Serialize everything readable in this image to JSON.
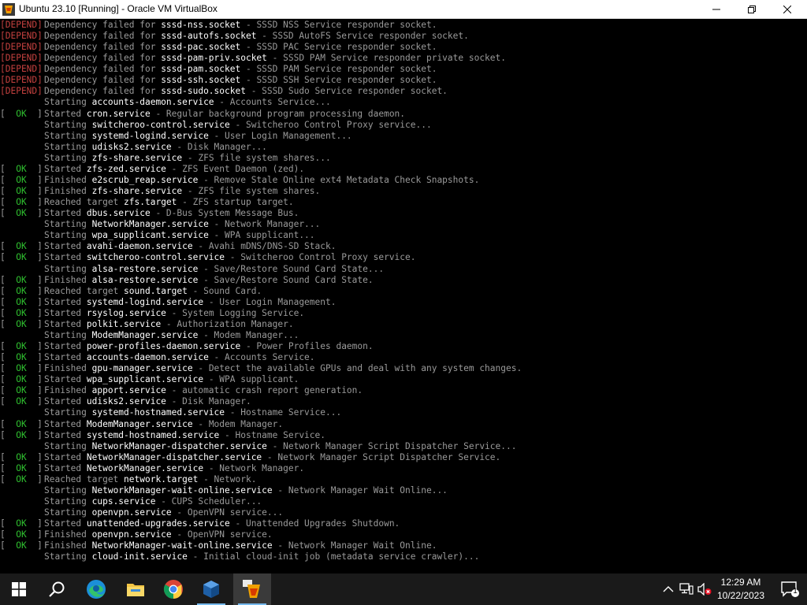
{
  "window": {
    "title": "Ubuntu 23.10 [Running] - Oracle VM VirtualBox",
    "controls": [
      "minimize",
      "maximize",
      "close"
    ]
  },
  "console": {
    "lines": [
      {
        "status": "DEPEND",
        "verb": "Dependency failed for",
        "unit": "sssd-nss.socket",
        "desc": " - SSSD NSS Service responder socket."
      },
      {
        "status": "DEPEND",
        "verb": "Dependency failed for",
        "unit": "sssd-autofs.socket",
        "desc": " - SSSD AutoFS Service responder socket."
      },
      {
        "status": "DEPEND",
        "verb": "Dependency failed for",
        "unit": "sssd-pac.socket",
        "desc": " - SSSD PAC Service responder socket."
      },
      {
        "status": "DEPEND",
        "verb": "Dependency failed for",
        "unit": "sssd-pam-priv.socket",
        "desc": " - SSSD PAM Service responder private socket."
      },
      {
        "status": "DEPEND",
        "verb": "Dependency failed for",
        "unit": "sssd-pam.socket",
        "desc": " - SSSD PAM Service responder socket."
      },
      {
        "status": "DEPEND",
        "verb": "Dependency failed for",
        "unit": "sssd-ssh.socket",
        "desc": " - SSSD SSH Service responder socket."
      },
      {
        "status": "DEPEND",
        "verb": "Dependency failed for",
        "unit": "sssd-sudo.socket",
        "desc": " - SSSD Sudo Service responder socket."
      },
      {
        "status": "",
        "verb": "Starting",
        "unit": "accounts-daemon.service",
        "desc": " - Accounts Service..."
      },
      {
        "status": "OK",
        "verb": "Started",
        "unit": "cron.service",
        "desc": " - Regular background program processing daemon."
      },
      {
        "status": "",
        "verb": "Starting",
        "unit": "switcheroo-control.service",
        "desc": " - Switcheroo Control Proxy service..."
      },
      {
        "status": "",
        "verb": "Starting",
        "unit": "systemd-logind.service",
        "desc": " - User Login Management..."
      },
      {
        "status": "",
        "verb": "Starting",
        "unit": "udisks2.service",
        "desc": " - Disk Manager..."
      },
      {
        "status": "",
        "verb": "Starting",
        "unit": "zfs-share.service",
        "desc": " - ZFS file system shares..."
      },
      {
        "status": "OK",
        "verb": "Started",
        "unit": "zfs-zed.service",
        "desc": " - ZFS Event Daemon (zed)."
      },
      {
        "status": "OK",
        "verb": "Finished",
        "unit": "e2scrub_reap.service",
        "desc": " - Remove Stale Online ext4 Metadata Check Snapshots."
      },
      {
        "status": "OK",
        "verb": "Finished",
        "unit": "zfs-share.service",
        "desc": " - ZFS file system shares."
      },
      {
        "status": "OK",
        "verb": "Reached target",
        "unit": "zfs.target",
        "desc": " - ZFS startup target."
      },
      {
        "status": "OK",
        "verb": "Started",
        "unit": "dbus.service",
        "desc": " - D-Bus System Message Bus."
      },
      {
        "status": "",
        "verb": "Starting",
        "unit": "NetworkManager.service",
        "desc": " - Network Manager..."
      },
      {
        "status": "",
        "verb": "Starting",
        "unit": "wpa_supplicant.service",
        "desc": " - WPA supplicant..."
      },
      {
        "status": "OK",
        "verb": "Started",
        "unit": "avahi-daemon.service",
        "desc": " - Avahi mDNS/DNS-SD Stack."
      },
      {
        "status": "OK",
        "verb": "Started",
        "unit": "switcheroo-control.service",
        "desc": " - Switcheroo Control Proxy service."
      },
      {
        "status": "",
        "verb": "Starting",
        "unit": "alsa-restore.service",
        "desc": " - Save/Restore Sound Card State..."
      },
      {
        "status": "OK",
        "verb": "Finished",
        "unit": "alsa-restore.service",
        "desc": " - Save/Restore Sound Card State."
      },
      {
        "status": "OK",
        "verb": "Reached target",
        "unit": "sound.target",
        "desc": " - Sound Card."
      },
      {
        "status": "OK",
        "verb": "Started",
        "unit": "systemd-logind.service",
        "desc": " - User Login Management."
      },
      {
        "status": "OK",
        "verb": "Started",
        "unit": "rsyslog.service",
        "desc": " - System Logging Service."
      },
      {
        "status": "OK",
        "verb": "Started",
        "unit": "polkit.service",
        "desc": " - Authorization Manager."
      },
      {
        "status": "",
        "verb": "Starting",
        "unit": "ModemManager.service",
        "desc": " - Modem Manager..."
      },
      {
        "status": "OK",
        "verb": "Started",
        "unit": "power-profiles-daemon.service",
        "desc": " - Power Profiles daemon."
      },
      {
        "status": "OK",
        "verb": "Started",
        "unit": "accounts-daemon.service",
        "desc": " - Accounts Service."
      },
      {
        "status": "OK",
        "verb": "Finished",
        "unit": "gpu-manager.service",
        "desc": " - Detect the available GPUs and deal with any system changes."
      },
      {
        "status": "OK",
        "verb": "Started",
        "unit": "wpa_supplicant.service",
        "desc": " - WPA supplicant."
      },
      {
        "status": "OK",
        "verb": "Finished",
        "unit": "apport.service",
        "desc": " - automatic crash report generation."
      },
      {
        "status": "OK",
        "verb": "Started",
        "unit": "udisks2.service",
        "desc": " - Disk Manager."
      },
      {
        "status": "",
        "verb": "Starting",
        "unit": "systemd-hostnamed.service",
        "desc": " - Hostname Service..."
      },
      {
        "status": "OK",
        "verb": "Started",
        "unit": "ModemManager.service",
        "desc": " - Modem Manager."
      },
      {
        "status": "OK",
        "verb": "Started",
        "unit": "systemd-hostnamed.service",
        "desc": " - Hostname Service."
      },
      {
        "status": "",
        "verb": "Starting",
        "unit": "NetworkManager-dispatcher.service",
        "desc": " - Network Manager Script Dispatcher Service..."
      },
      {
        "status": "OK",
        "verb": "Started",
        "unit": "NetworkManager-dispatcher.service",
        "desc": " - Network Manager Script Dispatcher Service."
      },
      {
        "status": "OK",
        "verb": "Started",
        "unit": "NetworkManager.service",
        "desc": " - Network Manager."
      },
      {
        "status": "OK",
        "verb": "Reached target",
        "unit": "network.target",
        "desc": " - Network."
      },
      {
        "status": "",
        "verb": "Starting",
        "unit": "NetworkManager-wait-online.service",
        "desc": " - Network Manager Wait Online..."
      },
      {
        "status": "",
        "verb": "Starting",
        "unit": "cups.service",
        "desc": " - CUPS Scheduler..."
      },
      {
        "status": "",
        "verb": "Starting",
        "unit": "openvpn.service",
        "desc": " - OpenVPN service..."
      },
      {
        "status": "OK",
        "verb": "Started",
        "unit": "unattended-upgrades.service",
        "desc": " - Unattended Upgrades Shutdown."
      },
      {
        "status": "OK",
        "verb": "Finished",
        "unit": "openvpn.service",
        "desc": " - OpenVPN service."
      },
      {
        "status": "OK",
        "verb": "Finished",
        "unit": "NetworkManager-wait-online.service",
        "desc": " - Network Manager Wait Online."
      },
      {
        "status": "",
        "verb": "Starting",
        "unit": "cloud-init.service",
        "desc": " - Initial cloud-init job (metadata service crawler)..."
      }
    ]
  },
  "taskbar": {
    "apps": [
      {
        "name": "Start",
        "icon": "windows-start-icon"
      },
      {
        "name": "Search",
        "icon": "search-icon"
      },
      {
        "name": "Microsoft Edge",
        "icon": "edge-icon"
      },
      {
        "name": "File Explorer",
        "icon": "file-explorer-icon"
      },
      {
        "name": "Google Chrome",
        "icon": "chrome-icon"
      },
      {
        "name": "Oracle VM VirtualBox Manager",
        "icon": "virtualbox-icon"
      },
      {
        "name": "Ubuntu 23.10 [Running]",
        "icon": "virtualbox-vm-icon"
      }
    ],
    "tray": {
      "time": "12:29 AM",
      "date": "10/22/2023",
      "notification_count": "1"
    }
  },
  "colors": {
    "ok": "#2fbf2f",
    "depend": "#c5413f",
    "unit": "#ffffff",
    "text": "#9a9a9a",
    "taskbar": "#1a1a1a"
  }
}
